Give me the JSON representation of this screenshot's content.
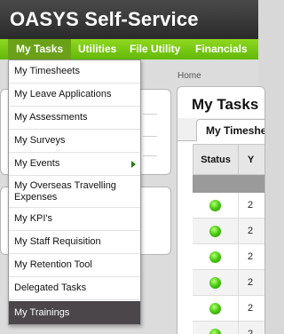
{
  "app": {
    "title": "OASYS Self-Service"
  },
  "nav": {
    "items": [
      {
        "label": "My Tasks"
      },
      {
        "label": "Utilities"
      },
      {
        "label": "File Utility"
      },
      {
        "label": "Financials"
      }
    ]
  },
  "breadcrumb": "Home",
  "tasks": {
    "title": "My Tasks",
    "tab": "My Timesheets",
    "columns": [
      "Status",
      "Y"
    ],
    "rows": [
      {
        "status": "green",
        "year": "2"
      },
      {
        "status": "green",
        "year": "2"
      },
      {
        "status": "green",
        "year": "2"
      },
      {
        "status": "green",
        "year": "2"
      },
      {
        "status": "green",
        "year": "2"
      },
      {
        "status": "green",
        "year": "2"
      }
    ]
  },
  "menu": {
    "items": [
      {
        "label": "My Timesheets"
      },
      {
        "label": "My Leave Applications"
      },
      {
        "label": "My Assessments"
      },
      {
        "label": "My Surveys"
      },
      {
        "label": "My Events"
      },
      {
        "label": "My Overseas Travelling Expenses"
      },
      {
        "label": "My KPI's"
      },
      {
        "label": "My Staff Requisition"
      },
      {
        "label": "My Retention Tool"
      },
      {
        "label": "Delegated Tasks"
      },
      {
        "label": "My Trainings"
      }
    ]
  },
  "colors": {
    "accent": "#7cc813",
    "header": "#333333",
    "highlight": "#4a4649"
  }
}
